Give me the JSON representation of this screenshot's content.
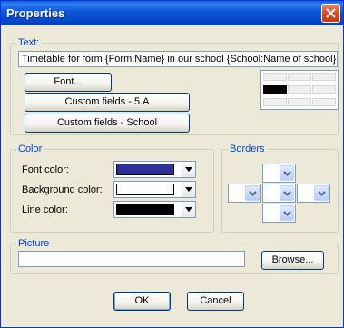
{
  "window": {
    "title": "Properties"
  },
  "text_group": {
    "legend": "Text:",
    "value": "Timetable for form {Form:Name} in our school {School:Name of school}",
    "font_button": "Font...",
    "custom_fields_class_button": "Custom fields - 5.A",
    "custom_fields_school_button": "Custom fields - School",
    "alignment_grid": {
      "rows": 3,
      "cols": 3,
      "selected_row": 1,
      "selected_col": 0
    }
  },
  "color_group": {
    "legend": "Color",
    "font_color_label": "Font color:",
    "font_color": "#2e2e9a",
    "background_color_label": "Background color:",
    "background_color": "#ffffff",
    "line_color_label": "Line color:",
    "line_color": "#000000"
  },
  "borders_group": {
    "legend": "Borders"
  },
  "picture_group": {
    "legend": "Picture",
    "path": "",
    "browse_button": "Browse..."
  },
  "dialog_buttons": {
    "ok": "OK",
    "cancel": "Cancel"
  },
  "colors": {
    "title_bar": "#0a56d6",
    "legend": "#0046d5",
    "dialog_bg": "#ece9d8"
  }
}
